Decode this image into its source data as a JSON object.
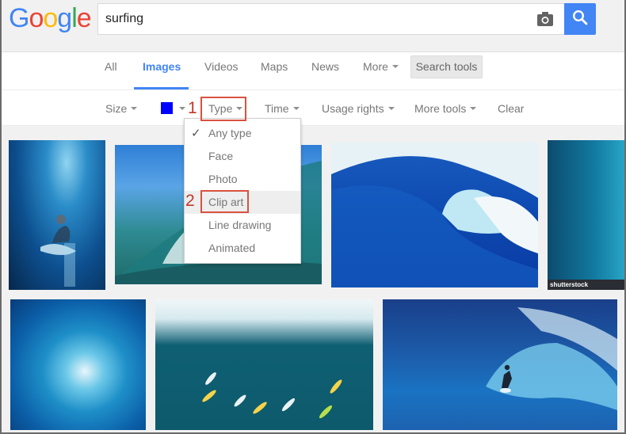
{
  "logo": {
    "letters": [
      {
        "char": "G",
        "color": "#4285f4"
      },
      {
        "char": "o",
        "color": "#ea4335"
      },
      {
        "char": "o",
        "color": "#fbbc05"
      },
      {
        "char": "g",
        "color": "#4285f4"
      },
      {
        "char": "l",
        "color": "#34a853"
      },
      {
        "char": "e",
        "color": "#ea4335"
      }
    ]
  },
  "search": {
    "query": "surfing",
    "camera_icon": "camera-icon",
    "search_icon": "search-icon"
  },
  "tabs": [
    {
      "label": "All",
      "active": false
    },
    {
      "label": "Images",
      "active": true
    },
    {
      "label": "Videos",
      "active": false
    },
    {
      "label": "Maps",
      "active": false
    },
    {
      "label": "News",
      "active": false
    },
    {
      "label": "More",
      "active": false,
      "has_caret": true
    }
  ],
  "search_tools_label": "Search tools",
  "tools": {
    "size": "Size",
    "color_value": "#0000ff",
    "type": "Type",
    "time": "Time",
    "usage_rights": "Usage rights",
    "more_tools": "More tools",
    "clear": "Clear"
  },
  "annotations": {
    "step1": "1",
    "step2": "2"
  },
  "type_dropdown": {
    "items": [
      {
        "label": "Any type",
        "checked": true
      },
      {
        "label": "Face",
        "checked": false
      },
      {
        "label": "Photo",
        "checked": false
      },
      {
        "label": "Clip art",
        "checked": false,
        "highlighted": true
      },
      {
        "label": "Line drawing",
        "checked": false
      },
      {
        "label": "Animated",
        "checked": false
      }
    ],
    "check_glyph": "✓"
  },
  "images": [
    {
      "desc": "underwater surfer",
      "watermark": ""
    },
    {
      "desc": "breaking wave blue sky",
      "watermark": ""
    },
    {
      "desc": "blue barrel wave",
      "watermark": ""
    },
    {
      "desc": "underwater wave",
      "watermark": "shutterstock"
    },
    {
      "desc": "wave tube",
      "watermark": ""
    },
    {
      "desc": "group of surfers on wave",
      "watermark": ""
    },
    {
      "desc": "surfer in barrel",
      "watermark": ""
    }
  ]
}
